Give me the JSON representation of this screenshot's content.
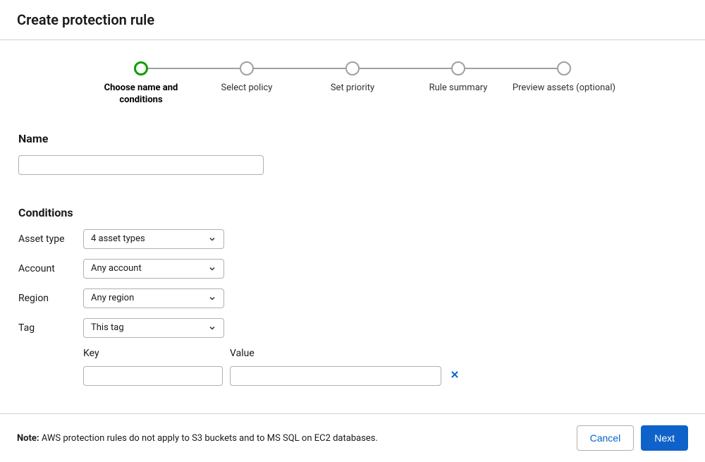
{
  "header": {
    "title": "Create protection rule"
  },
  "stepper": {
    "steps": [
      {
        "label": "Choose name and conditions",
        "active": true
      },
      {
        "label": "Select policy",
        "active": false
      },
      {
        "label": "Set priority",
        "active": false
      },
      {
        "label": "Rule summary",
        "active": false
      },
      {
        "label": "Preview assets (optional)",
        "active": false
      }
    ]
  },
  "form": {
    "name_label": "Name",
    "conditions_label": "Conditions",
    "asset_type": {
      "label": "Asset type",
      "value": "4 asset types"
    },
    "account": {
      "label": "Account",
      "value": "Any account"
    },
    "region": {
      "label": "Region",
      "value": "Any region"
    },
    "tag": {
      "label": "Tag",
      "value": "This tag"
    },
    "tag_key_label": "Key",
    "tag_value_label": "Value"
  },
  "footer": {
    "note_prefix": "Note:",
    "note_text": " AWS protection rules do not apply to S3 buckets and to MS SQL on EC2 databases.",
    "cancel": "Cancel",
    "next": "Next"
  }
}
